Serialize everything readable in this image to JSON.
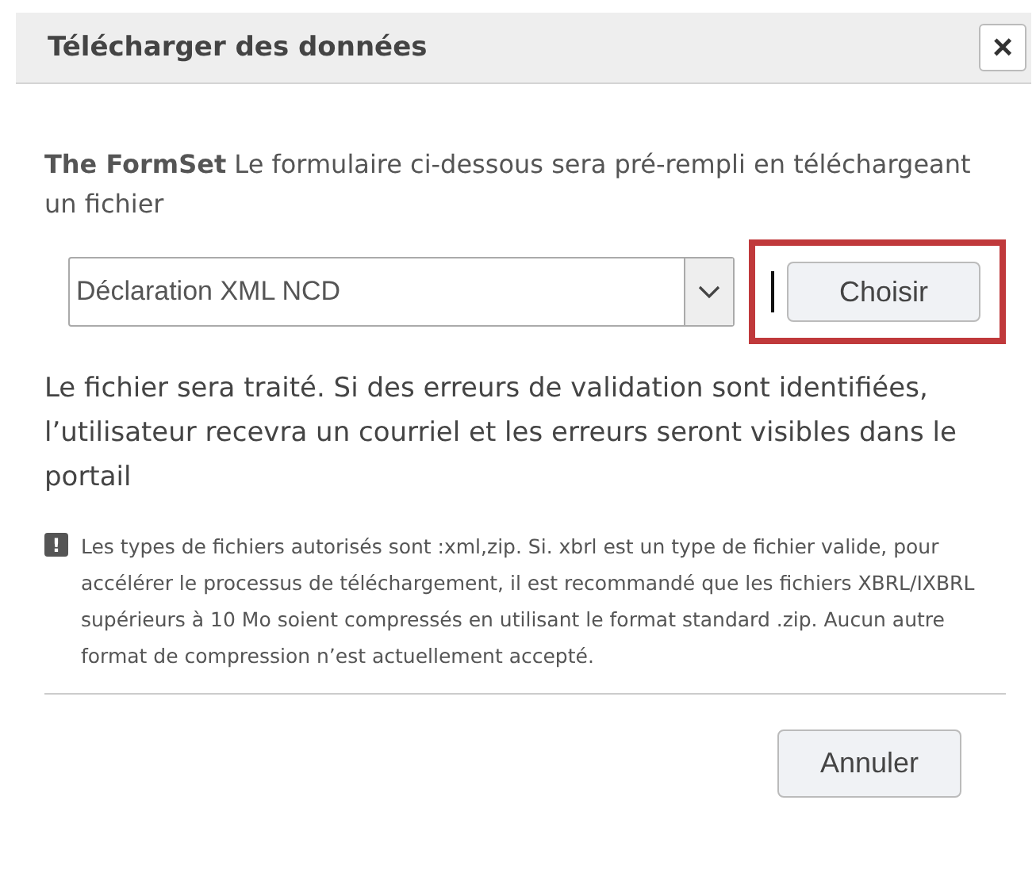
{
  "dialog": {
    "title": "Télécharger des données",
    "close": "×"
  },
  "intro": "**The FormSet** Le formulaire ci-dessous sera pré-rempli en téléchargeant un fichier",
  "file_type": {
    "value": "Déclaration XML NCD"
  },
  "choose_button": {
    "label": "Choisir",
    "highlighted": true
  },
  "info": "Le fichier sera traité. Si des erreurs de validation sont identifiées, l’utilisateur recevra un courriel et les erreurs seront visibles dans le portail",
  "note": {
    "icon": "!",
    "text": "Les types de fichiers autorisés sont :xml,zip. Si. xbrl est un type de fichier valide, pour accélérer le processus de téléchargement, il est recommandé que les fichiers XBRL/IXBRL supérieurs à 10 Mo soient compressés en utilisant le format standard .zip. Aucun autre format de compression n’est actuellement accepté."
  },
  "buttons": [
    "Annuler"
  ]
}
